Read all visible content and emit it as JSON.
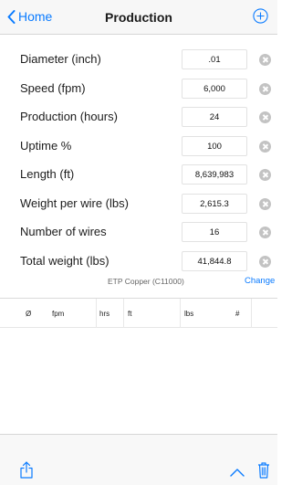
{
  "nav": {
    "back_label": "Home",
    "title": "Production"
  },
  "fields": [
    {
      "label": "Diameter (inch)",
      "value": ".01"
    },
    {
      "label": "Speed (fpm)",
      "value": "6,000"
    },
    {
      "label": "Production (hours)",
      "value": "24"
    },
    {
      "label": "Uptime %",
      "value": "100"
    },
    {
      "label": "Length (ft)",
      "value": "8,639,983"
    },
    {
      "label": "Weight per wire (lbs)",
      "value": "2,615.3"
    },
    {
      "label": "Number of wires",
      "value": "16"
    },
    {
      "label": "Total weight (lbs)",
      "value": "41,844.8"
    }
  ],
  "material": {
    "name": "ETP Copper (C11000)",
    "change_label": "Change"
  },
  "table": {
    "columns": [
      "Ø",
      "fpm",
      "hrs",
      "ft",
      "lbs",
      "#"
    ]
  },
  "icons": {
    "back": "chevron-left-icon",
    "add": "plus-circle-icon",
    "clear": "clear-circle-icon",
    "share": "share-icon",
    "up": "chevron-up-icon",
    "trash": "trash-icon"
  },
  "colors": {
    "accent": "#0a7bff",
    "clear_button": "#c3c3c3"
  }
}
